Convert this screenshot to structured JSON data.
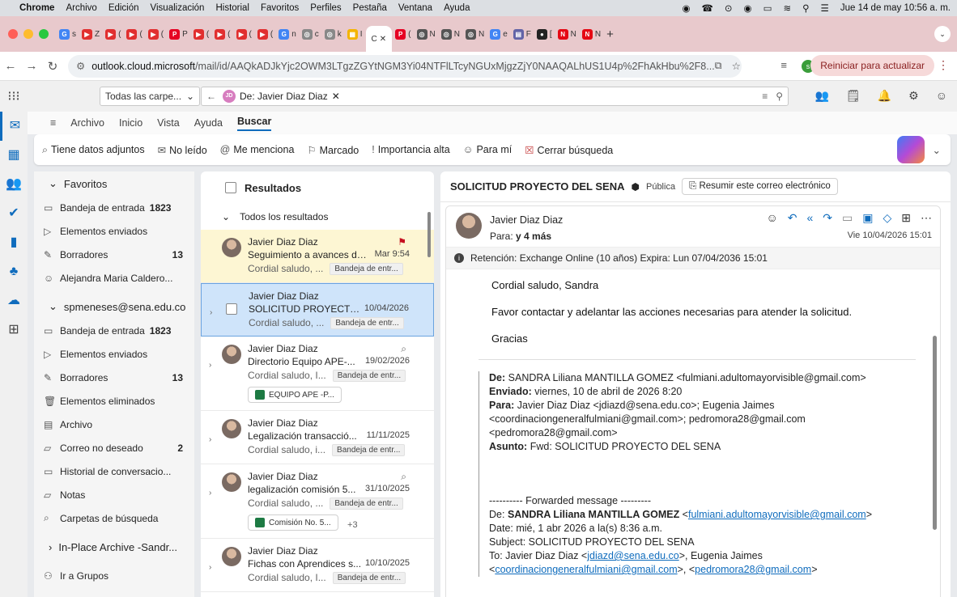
{
  "menubar": {
    "app": "Chrome",
    "items": [
      "Archivo",
      "Edición",
      "Visualización",
      "Historial",
      "Favoritos",
      "Perfiles",
      "Pestaña",
      "Ventana",
      "Ayuda"
    ],
    "clock": "Jue 14 de may  10:56 a. m."
  },
  "tabs": {
    "active_close": "✕",
    "new_tab": "+",
    "letters": [
      "s",
      "Z",
      "(",
      "(",
      "(",
      "P",
      "(",
      "(",
      "(",
      "(",
      "n",
      "c",
      "k",
      "I",
      "C",
      "(",
      "N",
      "N",
      "N",
      "e",
      "F",
      "[",
      "N",
      "N"
    ]
  },
  "address": {
    "host": "outlook.cloud.microsoft",
    "path": "/mail/id/AAQkADJkYjc2OWM3LTgzZGYtNGM3Yi04NTFlLTcyNGUxMjgzZjY0NAAQALhUS1U4p%2FhAkHbu%2F8...",
    "profile_letter": "s",
    "reload_label": "Reiniciar para actualizar"
  },
  "outlook_header": {
    "folder_scope": "Todas las carpe...",
    "search_chip_initials": "JD",
    "search_chip_label": "De: Javier Diaz Diaz"
  },
  "ribbon_tabs": [
    "Archivo",
    "Inicio",
    "Vista",
    "Ayuda",
    "Buscar"
  ],
  "ribbon": {
    "attachments": "Tiene datos adjuntos",
    "unread": "No leído",
    "mentions": "Me menciona",
    "flagged": "Marcado",
    "importance": "Importancia alta",
    "to_me": "Para mí",
    "close_search": "Cerrar búsqueda"
  },
  "folders": {
    "favorites_label": "Favoritos",
    "favorites": [
      {
        "label": "Bandeja de entrada",
        "count": "1823",
        "icon": "inbox-icon"
      },
      {
        "label": "Elementos enviados",
        "count": "",
        "icon": "send-icon"
      },
      {
        "label": "Borradores",
        "count": "13",
        "icon": "drafts-icon"
      },
      {
        "label": "Alejandra Maria Caldero...",
        "count": "",
        "icon": "person-icon"
      }
    ],
    "account_label": "spmeneses@sena.edu.co",
    "account": [
      {
        "label": "Bandeja de entrada",
        "count": "1823",
        "icon": "inbox-icon"
      },
      {
        "label": "Elementos enviados",
        "count": "",
        "icon": "send-icon"
      },
      {
        "label": "Borradores",
        "count": "13",
        "icon": "drafts-icon"
      },
      {
        "label": "Elementos eliminados",
        "count": "",
        "icon": "trash-icon"
      },
      {
        "label": "Archivo",
        "count": "",
        "icon": "archive-icon"
      },
      {
        "label": "Correo no deseado",
        "count": "2",
        "icon": "junk-icon"
      },
      {
        "label": "Historial de conversacio...",
        "count": "",
        "icon": "folder-icon"
      },
      {
        "label": "Notas",
        "count": "",
        "icon": "notes-icon"
      },
      {
        "label": "Carpetas de búsqueda",
        "count": "",
        "icon": "search-folder-icon"
      }
    ],
    "archive_label": "In-Place Archive -Sandr...",
    "groups_label": "Ir a Grupos"
  },
  "msglist": {
    "header": "Resultados",
    "group": "Todos los resultados",
    "messages": [
      {
        "from": "Javier Diaz Diaz",
        "subject": "Seguimiento a avances de...",
        "date": "Mar 9:54",
        "preview": "Cordial saludo, ...",
        "tag": "Bandeja de entr...",
        "attachment": "",
        "extra": ""
      },
      {
        "from": "Javier Diaz Diaz",
        "subject": "SOLICITUD PROYECTO ...",
        "date": "10/04/2026",
        "preview": "Cordial saludo, ...",
        "tag": "Bandeja de entr...",
        "attachment": "",
        "extra": ""
      },
      {
        "from": "Javier Diaz Diaz",
        "subject": "Directorio Equipo APE-...",
        "date": "19/02/2026",
        "preview": "Cordial saludo, I...",
        "tag": "Bandeja de entr...",
        "attachment": "EQUIPO APE -P...",
        "extra": ""
      },
      {
        "from": "Javier Diaz Diaz",
        "subject": "Legalización transacció...",
        "date": "11/11/2025",
        "preview": "Cordial saludo, i...",
        "tag": "Bandeja de entr...",
        "attachment": "",
        "extra": ""
      },
      {
        "from": "Javier Diaz Diaz",
        "subject": "legalización comisión 5...",
        "date": "31/10/2025",
        "preview": "Cordial saludo, ...",
        "tag": "Bandeja de entr...",
        "attachment": "Comisión No. 5...",
        "extra": "+3"
      },
      {
        "from": "Javier Diaz Diaz",
        "subject": "Fichas con Aprendices s...",
        "date": "10/10/2025",
        "preview": "Cordial saludo, I...",
        "tag": "Bandeja de entr...",
        "attachment": "",
        "extra": ""
      }
    ]
  },
  "reading": {
    "title": "SOLICITUD PROYECTO DEL SENA",
    "visibility": "Pública",
    "summarize": "Resumir este correo electrónico",
    "sender": "Javier Diaz Diaz",
    "to_label": "Para:",
    "to_value": "y 4 más",
    "date": "Vie 10/04/2026 15:01",
    "retention": "Retención: Exchange Online (10 años) Expira: Lun 07/04/2036 15:01",
    "body": [
      "Cordial saludo, Sandra",
      "Favor contactar y adelantar las acciones necesarias para atender la solicitud.",
      "Gracias"
    ],
    "quote": {
      "from_label": "De:",
      "from": "SANDRA Liliana MANTILLA GOMEZ <fulmiani.adultomayorvisible@gmail.com>",
      "sent_label": "Enviado:",
      "sent": "viernes, 10 de abril de 2026 8:20",
      "to_label": "Para:",
      "to_1": "Javier Diaz Diaz <jdiazd@sena.edu.co>; Eugenia Jaimes",
      "to_2": "<coordinaciongeneralfulmiani@gmail.com>; pedromora28@gmail.com",
      "to_3": "<pedromora28@gmail.com>",
      "subject_label": "Asunto:",
      "subject": "Fwd: SOLICITUD PROYECTO DEL SENA"
    },
    "forward": {
      "divider": "---------- Forwarded message ---------",
      "from_label": "De:",
      "from_name": "SANDRA Liliana MANTILLA GOMEZ",
      "from_email": "fulmiani.adultomayorvisible@gmail.com",
      "date": "Date: mié, 1 abr 2026 a la(s) 8:36 a.m.",
      "subject": "Subject: SOLICITUD PROYECTO DEL SENA",
      "to_label": "To: Javier Diaz Diaz <",
      "to_email1": "jdiazd@sena.edu.co",
      "to_mid": ">, Eugenia Jaimes",
      "to_email2": "coordinaciongeneralfulmiani@gmail.com",
      "to_email3": "pedromora28@gmail.com"
    }
  }
}
